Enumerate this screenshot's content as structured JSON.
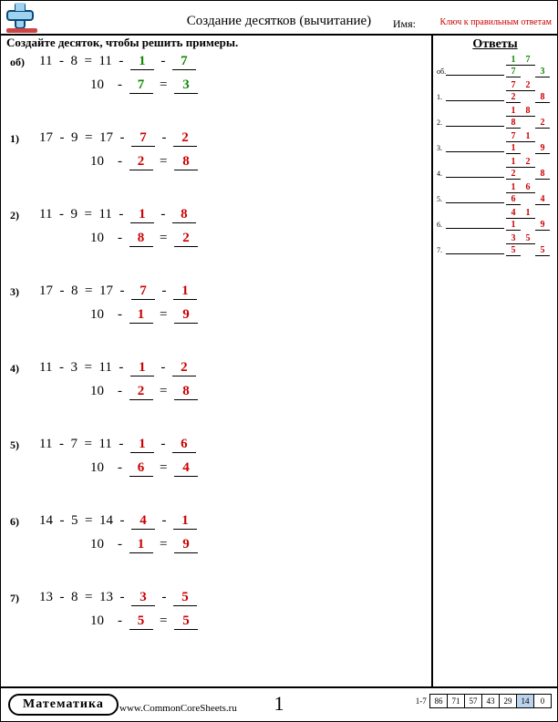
{
  "header": {
    "title": "Создание десятков (вычитание)",
    "name_label": "Имя:",
    "answer_key_label": "Ключ к правильным ответам",
    "instruction": "Создайте десяток, чтобы решить примеры."
  },
  "example": {
    "label": "об)",
    "a": "11",
    "b": "8",
    "s1": "1",
    "s2": "7",
    "s3": "7",
    "result": "3"
  },
  "problems": [
    {
      "label": "1)",
      "a": "17",
      "b": "9",
      "s1": "7",
      "s2": "2",
      "s3": "2",
      "result": "8"
    },
    {
      "label": "2)",
      "a": "11",
      "b": "9",
      "s1": "1",
      "s2": "8",
      "s3": "8",
      "result": "2"
    },
    {
      "label": "3)",
      "a": "17",
      "b": "8",
      "s1": "7",
      "s2": "1",
      "s3": "1",
      "result": "9"
    },
    {
      "label": "4)",
      "a": "11",
      "b": "3",
      "s1": "1",
      "s2": "2",
      "s3": "2",
      "result": "8"
    },
    {
      "label": "5)",
      "a": "11",
      "b": "7",
      "s1": "1",
      "s2": "6",
      "s3": "6",
      "result": "4"
    },
    {
      "label": "6)",
      "a": "14",
      "b": "5",
      "s1": "4",
      "s2": "1",
      "s3": "1",
      "result": "9"
    },
    {
      "label": "7)",
      "a": "13",
      "b": "8",
      "s1": "3",
      "s2": "5",
      "s3": "5",
      "result": "5"
    }
  ],
  "answers": {
    "title": "Ответы",
    "rows": [
      {
        "num": "об.",
        "top": [
          "1",
          "7",
          ""
        ],
        "bot": [
          "7",
          "",
          "3"
        ],
        "green": true
      },
      {
        "num": "1.",
        "top": [
          "7",
          "2",
          ""
        ],
        "bot": [
          "2",
          "",
          "8"
        ]
      },
      {
        "num": "2.",
        "top": [
          "1",
          "8",
          ""
        ],
        "bot": [
          "8",
          "",
          "2"
        ]
      },
      {
        "num": "3.",
        "top": [
          "7",
          "1",
          ""
        ],
        "bot": [
          "1",
          "",
          "9"
        ]
      },
      {
        "num": "4.",
        "top": [
          "1",
          "2",
          ""
        ],
        "bot": [
          "2",
          "",
          "8"
        ]
      },
      {
        "num": "5.",
        "top": [
          "1",
          "6",
          ""
        ],
        "bot": [
          "6",
          "",
          "4"
        ]
      },
      {
        "num": "6.",
        "top": [
          "4",
          "1",
          ""
        ],
        "bot": [
          "1",
          "",
          "9"
        ]
      },
      {
        "num": "7.",
        "top": [
          "3",
          "5",
          ""
        ],
        "bot": [
          "5",
          "",
          "5"
        ]
      }
    ]
  },
  "footer": {
    "subject": "Математика",
    "site": "www.CommonCoreSheets.ru",
    "page_number": "1",
    "score_label": "1-7",
    "score_values": [
      "86",
      "71",
      "57",
      "43",
      "29",
      "14",
      "0"
    ],
    "score_highlight_index": 5
  },
  "ten": "10"
}
